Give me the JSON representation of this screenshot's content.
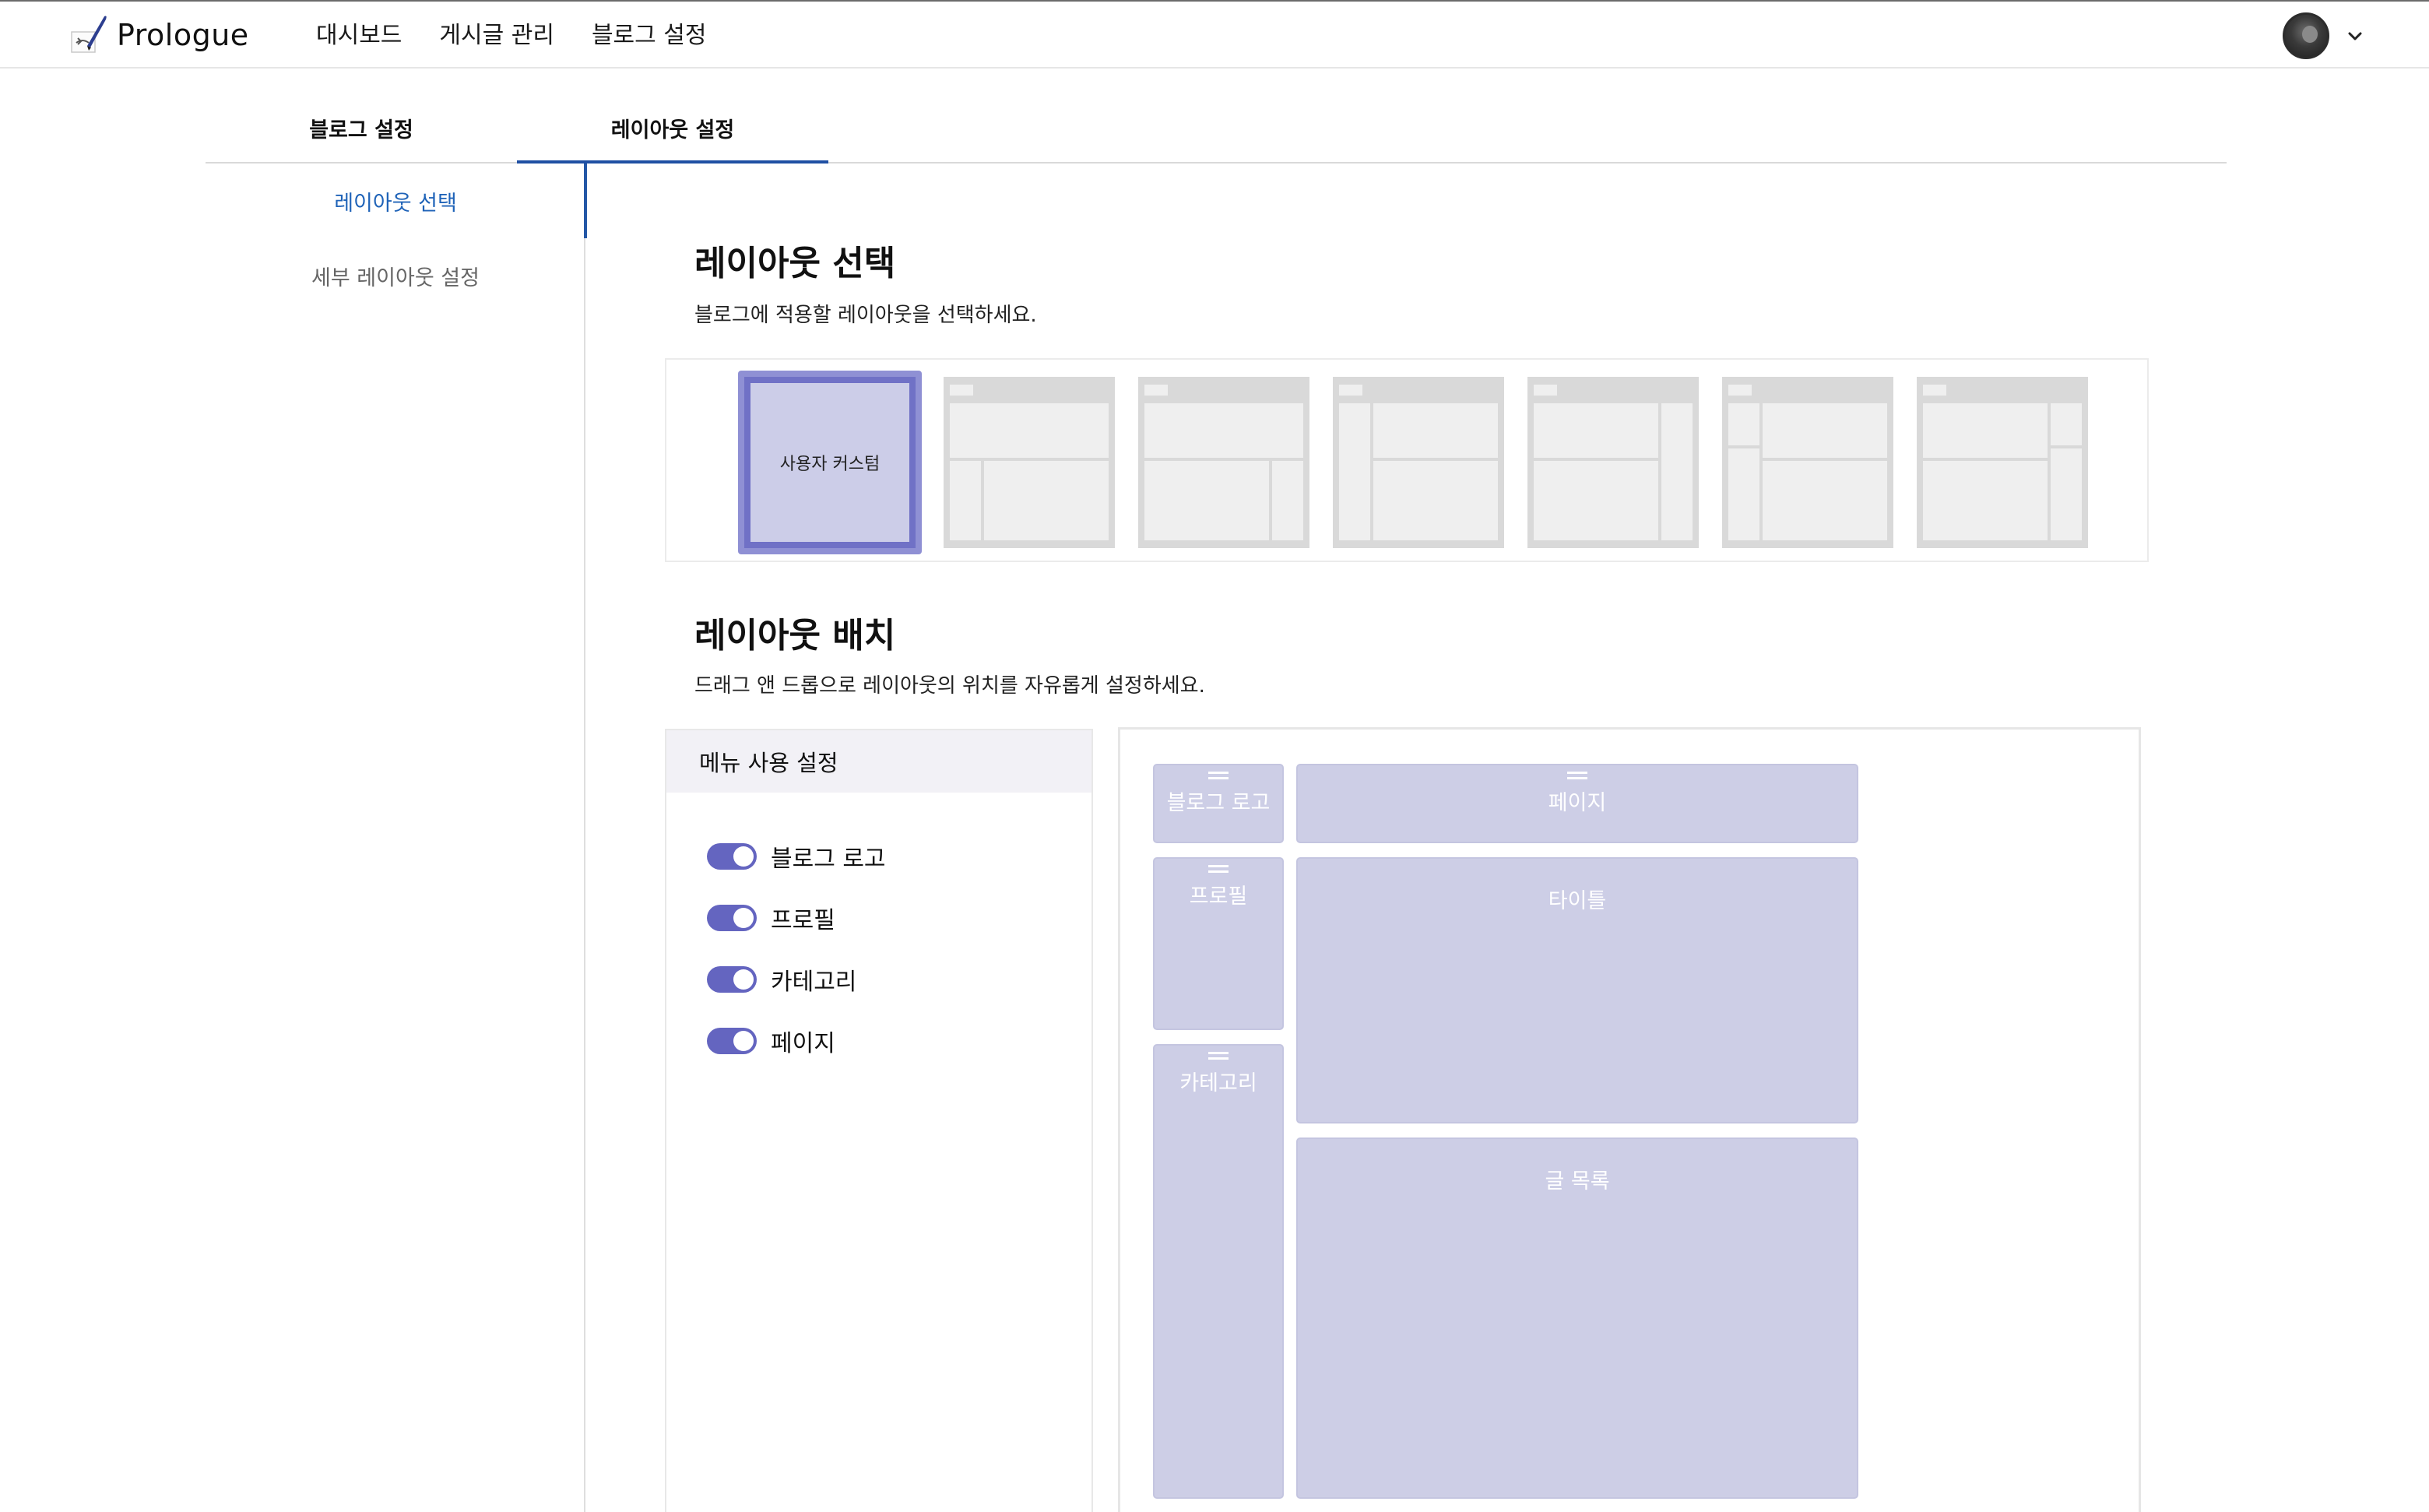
{
  "app": {
    "brand": "Prologue",
    "nav": [
      "대시보드",
      "게시글 관리",
      "블로그 설정"
    ]
  },
  "tabs": [
    "블로그 설정",
    "레이아웃 설정"
  ],
  "sidebar": {
    "items": [
      "레이아웃 선택",
      "세부 레이아웃 설정"
    ]
  },
  "layout_select": {
    "title": "레이아웃 선택",
    "description": "블로그에 적용할 레이아웃을 선택하세요.",
    "custom_label": "사용자 커스텀"
  },
  "layout_arrange": {
    "title": "레이아웃 배치",
    "description": "드래그 앤 드롭으로 레이아웃의 위치를 자유롭게 설정하세요."
  },
  "menu_settings": {
    "title": "메뉴 사용 설정",
    "toggles": [
      {
        "label": "블로그 로고",
        "on": true
      },
      {
        "label": "프로필",
        "on": true
      },
      {
        "label": "카테고리",
        "on": true
      },
      {
        "label": "페이지",
        "on": true
      }
    ]
  },
  "canvas_blocks": {
    "blog_logo": "블로그 로고",
    "page": "페이지",
    "profile": "프로필",
    "title": "타이틀",
    "category": "카테고리",
    "post_list": "글 목록"
  },
  "colors": {
    "accent": "#6465c0",
    "active_tab": "#1f4fa3",
    "active_sidebar_text": "#1f63b8",
    "block_fill": "#cdcee6"
  },
  "icons": {
    "brand": "quill-pen-icon",
    "profile_menu": "chevron-down-icon",
    "drag_handle": "drag-handle-icon"
  }
}
